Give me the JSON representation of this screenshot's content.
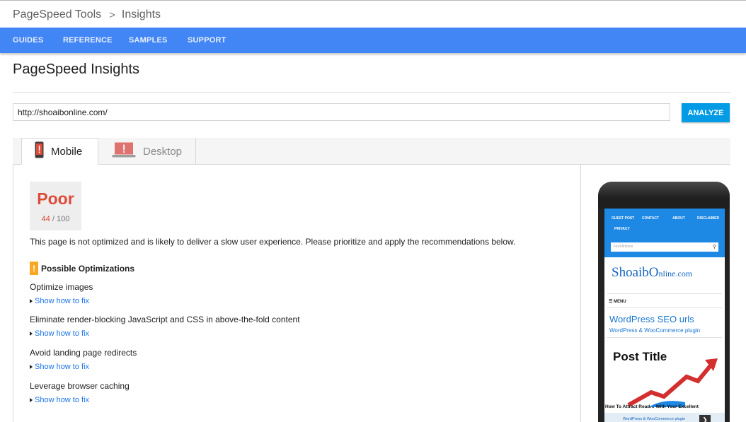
{
  "breadcrumb": {
    "root": "PageSpeed Tools",
    "separator": ">",
    "current": "Insights"
  },
  "nav": {
    "items": [
      "GUIDES",
      "REFERENCE",
      "SAMPLES",
      "SUPPORT"
    ]
  },
  "page_title": "PageSpeed Insights",
  "url_input": {
    "value": "http://shoaibonline.com/"
  },
  "analyze_label": "ANALYZE",
  "tabs": {
    "mobile": "Mobile",
    "desktop": "Desktop"
  },
  "score": {
    "label": "Poor",
    "value": "44",
    "max": "/ 100",
    "color": "#dd4b39"
  },
  "summary": "This page is not optimized and is likely to deliver a slow user experience. Please prioritize and apply the recommendations below.",
  "optimizations": {
    "badge": "!",
    "heading": "Possible Optimizations",
    "items": [
      {
        "title": "Optimize images",
        "link": "Show how to fix"
      },
      {
        "title": "Eliminate render-blocking JavaScript and CSS in above-the-fold content",
        "link": "Show how to fix"
      },
      {
        "title": "Avoid landing page redirects",
        "link": "Show how to fix"
      },
      {
        "title": "Leverage browser caching",
        "link": "Show how to fix"
      }
    ]
  },
  "preview": {
    "nav": [
      "GUEST POST",
      "CONTACT",
      "ABOUT",
      "DISCLAIMER",
      "PRIVACY"
    ],
    "search_placeholder": "Find Articles",
    "logo_main": "Shoaib",
    "logo_o": "O",
    "logo_rest": "nline.com",
    "menu": "MENU",
    "card_title": "WordPress SEO urls",
    "card_subtitle": "WordPress & WooCommerce plugin",
    "post_title": "Post Title",
    "post_caption": "How To Attract Read… With Your Excellent",
    "ad_text": "WordPress & WooCommerce plugin"
  },
  "colors": {
    "accent": "#4285f4",
    "button": "#039be5",
    "poor": "#dd4b39",
    "warning": "#f9a825",
    "link": "#1a73e8"
  }
}
